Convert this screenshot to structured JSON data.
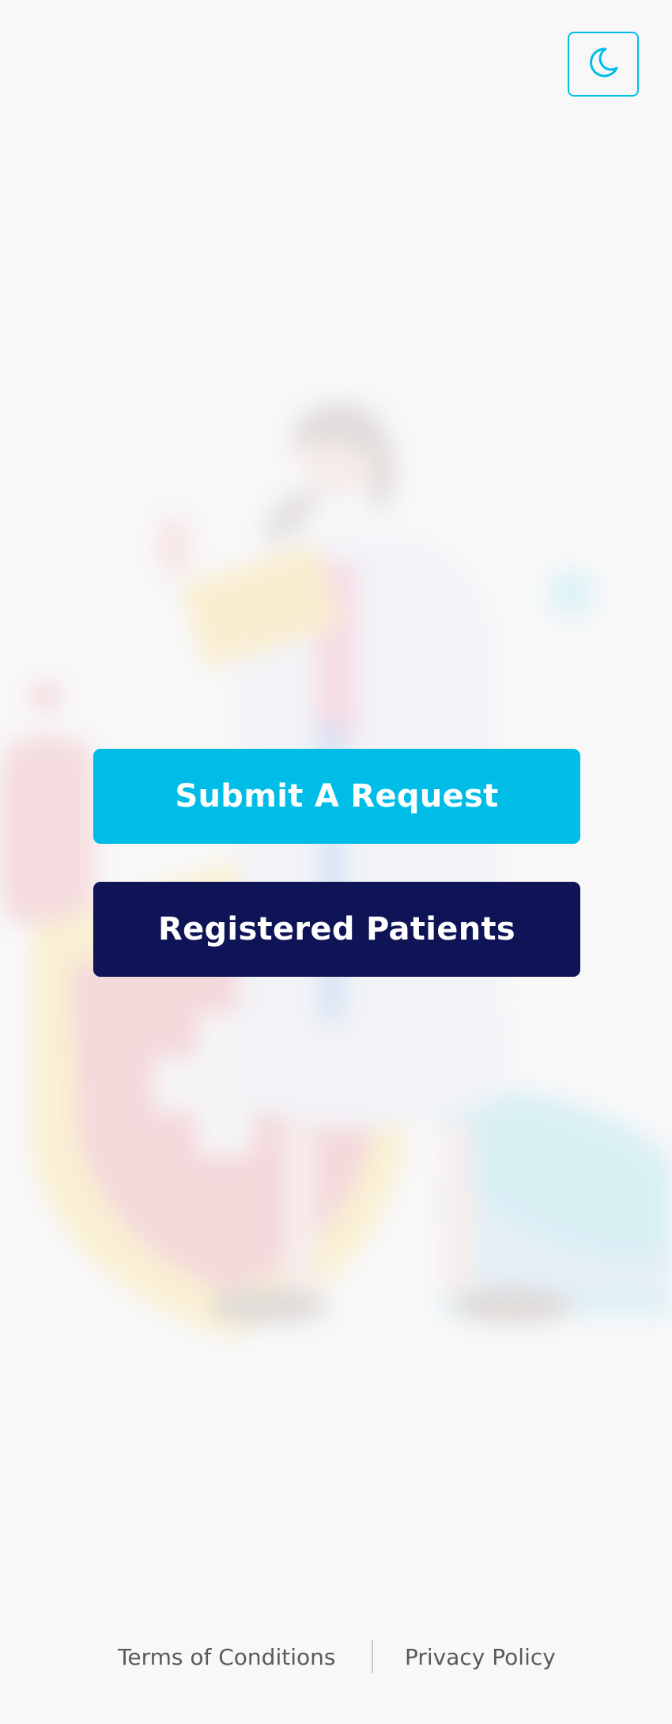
{
  "theme_toggle": {
    "icon": "moon-icon",
    "accent_color": "#00bde8"
  },
  "actions": {
    "submit_request_label": "Submit A Request",
    "registered_patients_label": "Registered Patients",
    "submit_color": "#00bde8",
    "registered_color": "#0e1455"
  },
  "background": {
    "illustration": "doctor-illustration"
  },
  "footer": {
    "terms_label": "Terms of Conditions",
    "privacy_label": "Privacy Policy"
  }
}
